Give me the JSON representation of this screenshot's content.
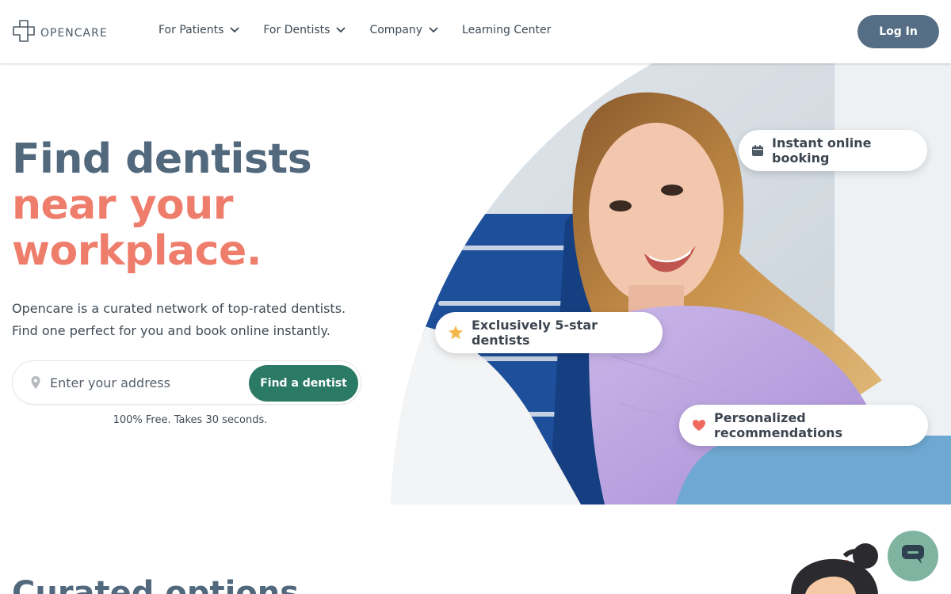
{
  "header": {
    "logo_text": "OPENCARE",
    "nav": [
      {
        "label": "For Patients",
        "has_dropdown": true
      },
      {
        "label": "For Dentists",
        "has_dropdown": true
      },
      {
        "label": "Company",
        "has_dropdown": true
      },
      {
        "label": "Learning Center",
        "has_dropdown": false
      }
    ],
    "login_label": "Log In"
  },
  "hero": {
    "title_line1": "Find dentists",
    "title_line2": "near your",
    "title_line3": "workplace.",
    "subtitle_line1": "Opencare is a curated network of top-rated dentists.",
    "subtitle_line2": "Find one perfect for you and book online instantly.",
    "search_placeholder": "Enter your address",
    "search_button": "Find a dentist",
    "note": "100% Free. Takes 30 seconds."
  },
  "badges": [
    {
      "label": "Instant online booking",
      "icon": "calendar-icon",
      "icon_color": "#4d5a66"
    },
    {
      "label": "Exclusively 5-star dentists",
      "icon": "star-icon",
      "icon_color": "#f2b84b"
    },
    {
      "label": "Personalized recommendations",
      "icon": "heart-icon",
      "icon_color": "#ef6b5f"
    }
  ],
  "section": {
    "title": "Curated options"
  },
  "colors": {
    "navy": "#51687d",
    "coral": "#ef7d6c",
    "green": "#2b7a65",
    "login": "#566e85",
    "chat": "#7fb5a0"
  }
}
